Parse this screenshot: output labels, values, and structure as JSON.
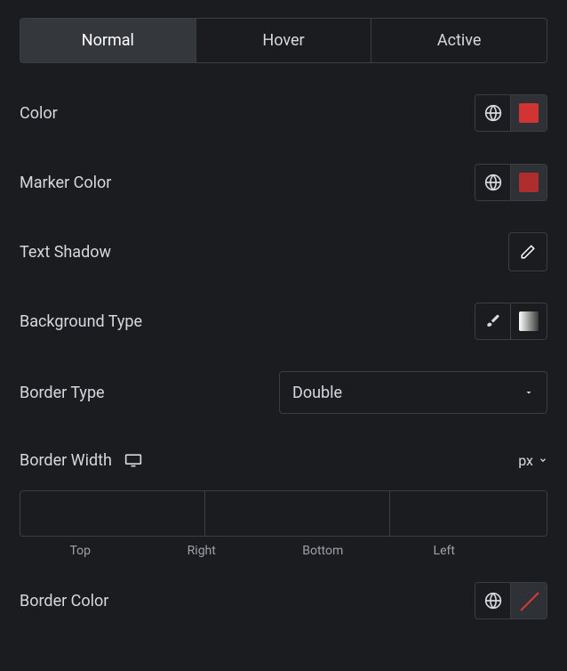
{
  "tabs": {
    "items": [
      "Normal",
      "Hover",
      "Active"
    ],
    "active_index": 0
  },
  "labels": {
    "color": "Color",
    "marker_color": "Marker Color",
    "text_shadow": "Text Shadow",
    "background_type": "Background Type",
    "border_type": "Border Type",
    "border_width": "Border Width",
    "border_color": "Border Color"
  },
  "values": {
    "color": "#d23333",
    "marker_color": "#b02d2d",
    "border_type": "Double",
    "unit": "px",
    "border_width": {
      "top": "",
      "right": "",
      "bottom": "",
      "left": ""
    }
  },
  "sides": {
    "top": "Top",
    "right": "Right",
    "bottom": "Bottom",
    "left": "Left"
  }
}
